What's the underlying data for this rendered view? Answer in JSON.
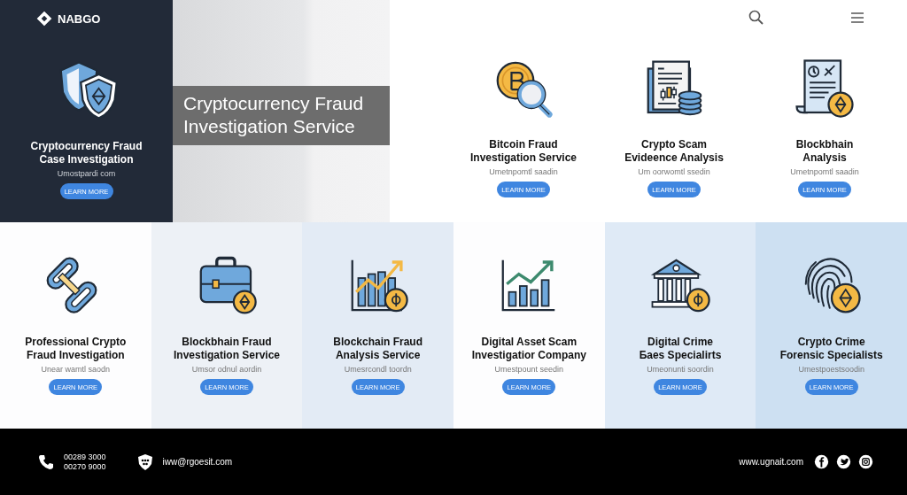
{
  "brand": {
    "name": "NABGO"
  },
  "hero": {
    "title": "Cryptocurrency Fraud Investigation Service"
  },
  "featured": {
    "title": "Cryptocurrency Fraud\nCase Investigation",
    "subtitle": "Umostpardi com",
    "button": "LEARN MORE"
  },
  "services_top": [
    {
      "title": "Bitcoin Fraud\nInvestigation Service",
      "subtitle": "Umetnpomtl saadin",
      "button": "LEARN MORE"
    },
    {
      "title": "Crypto Scam\nEvideence Analysis",
      "subtitle": "Um oorwomtl ssedin",
      "button": "LEARN MORE"
    },
    {
      "title": "Blockbhain\nAnalysis",
      "subtitle": "Umetnpomtl saadin",
      "button": "LEARN MORE"
    }
  ],
  "services_bottom": [
    {
      "title": "Professional Crypto\nFraud Investigation",
      "subtitle": "Unear wamtl saodn",
      "button": "LEARN MORE"
    },
    {
      "title": "Blockbhain Fraud\nInvestigation Service",
      "subtitle": "Umsor odnul aordin",
      "button": "LEARN MORE"
    },
    {
      "title": "Blockchain Fraud\nAnalysis Service",
      "subtitle": "Umesrcondl toordn",
      "button": "LEARN MORE"
    },
    {
      "title": "Digital Asset Scam\nInvestigatior Company",
      "subtitle": "Umestpount seedin",
      "button": "LEARN MORE"
    },
    {
      "title": "Digital Crime\nБaes Specialirts",
      "subtitle": "Umeonunti soordin",
      "button": "LEARN MORE"
    },
    {
      "title": "Crypto Crime\nForensic Specialists",
      "subtitle": "Umestpoestsoodin",
      "button": "LEARN MORE"
    }
  ],
  "footer": {
    "phones": [
      "00289 3000",
      "00270 9000"
    ],
    "email": "iww@rgoesit.com",
    "website": "www.ugnait.com"
  }
}
